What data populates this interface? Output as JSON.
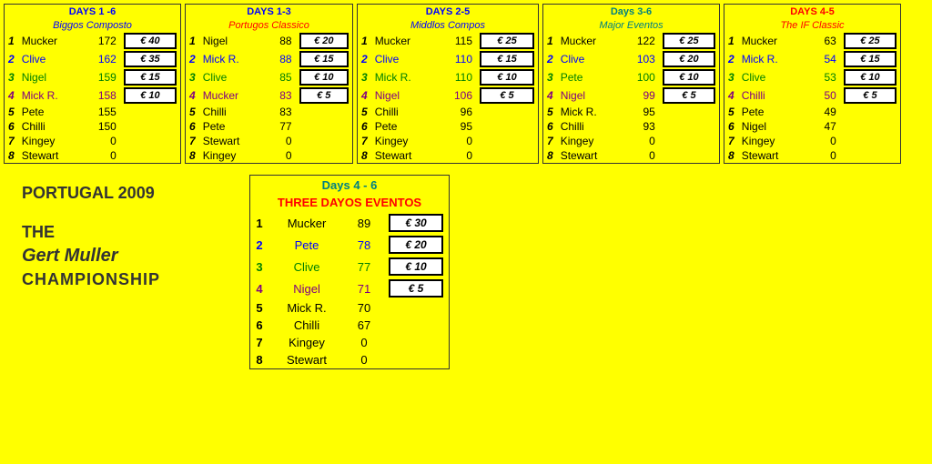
{
  "tournaments": [
    {
      "id": "days1-6",
      "header": "DAYS 1 -6",
      "header_color": "blue",
      "subheader": "Biggos Composto",
      "subheader_color": "blue",
      "rows": [
        {
          "rank": "1",
          "name": "Mucker",
          "score": "172",
          "prize": "€ 40"
        },
        {
          "rank": "2",
          "name": "Clive",
          "score": "162",
          "prize": "€ 35"
        },
        {
          "rank": "3",
          "name": "Nigel",
          "score": "159",
          "prize": "€ 15"
        },
        {
          "rank": "4",
          "name": "Mick R.",
          "score": "158",
          "prize": "€ 10"
        },
        {
          "rank": "5",
          "name": "Pete",
          "score": "155",
          "prize": null
        },
        {
          "rank": "6",
          "name": "Chilli",
          "score": "150",
          "prize": null
        },
        {
          "rank": "7",
          "name": "Kingey",
          "score": "0",
          "prize": null
        },
        {
          "rank": "8",
          "name": "Stewart",
          "score": "0",
          "prize": null
        }
      ]
    },
    {
      "id": "days1-3",
      "header": "DAYS 1-3",
      "header_color": "blue",
      "subheader": "Portugos Classico",
      "subheader_color": "red",
      "rows": [
        {
          "rank": "1",
          "name": "Nigel",
          "score": "88",
          "prize": "€ 20"
        },
        {
          "rank": "2",
          "name": "Mick R.",
          "score": "88",
          "prize": "€ 15"
        },
        {
          "rank": "3",
          "name": "Clive",
          "score": "85",
          "prize": "€ 10"
        },
        {
          "rank": "4",
          "name": "Mucker",
          "score": "83",
          "prize": "€ 5"
        },
        {
          "rank": "5",
          "name": "Chilli",
          "score": "83",
          "prize": null
        },
        {
          "rank": "6",
          "name": "Pete",
          "score": "77",
          "prize": null
        },
        {
          "rank": "7",
          "name": "Stewart",
          "score": "0",
          "prize": null
        },
        {
          "rank": "8",
          "name": "Kingey",
          "score": "0",
          "prize": null
        }
      ]
    },
    {
      "id": "days2-5",
      "header": "DAYS 2-5",
      "header_color": "blue",
      "subheader": "Middlos Compos",
      "subheader_color": "blue",
      "rows": [
        {
          "rank": "1",
          "name": "Mucker",
          "score": "115",
          "prize": "€ 25"
        },
        {
          "rank": "2",
          "name": "Clive",
          "score": "110",
          "prize": "€ 15"
        },
        {
          "rank": "3",
          "name": "Mick R.",
          "score": "110",
          "prize": "€ 10"
        },
        {
          "rank": "4",
          "name": "Nigel",
          "score": "106",
          "prize": "€ 5"
        },
        {
          "rank": "5",
          "name": "Chilli",
          "score": "96",
          "prize": null
        },
        {
          "rank": "6",
          "name": "Pete",
          "score": "95",
          "prize": null
        },
        {
          "rank": "7",
          "name": "Kingey",
          "score": "0",
          "prize": null
        },
        {
          "rank": "8",
          "name": "Stewart",
          "score": "0",
          "prize": null
        }
      ]
    },
    {
      "id": "days3-6",
      "header": "Days 3-6",
      "header_color": "teal",
      "subheader": "Major Eventos",
      "subheader_color": "teal",
      "rows": [
        {
          "rank": "1",
          "name": "Mucker",
          "score": "122",
          "prize": "€ 25"
        },
        {
          "rank": "2",
          "name": "Clive",
          "score": "103",
          "prize": "€ 20"
        },
        {
          "rank": "3",
          "name": "Pete",
          "score": "100",
          "prize": "€ 10"
        },
        {
          "rank": "4",
          "name": "Nigel",
          "score": "99",
          "prize": "€ 5"
        },
        {
          "rank": "5",
          "name": "Mick R.",
          "score": "95",
          "prize": null
        },
        {
          "rank": "6",
          "name": "Chilli",
          "score": "93",
          "prize": null
        },
        {
          "rank": "7",
          "name": "Kingey",
          "score": "0",
          "prize": null
        },
        {
          "rank": "8",
          "name": "Stewart",
          "score": "0",
          "prize": null
        }
      ]
    },
    {
      "id": "days4-5",
      "header": "DAYS 4-5",
      "header_color": "red",
      "subheader": "The IF Classic",
      "subheader_color": "red",
      "rows": [
        {
          "rank": "1",
          "name": "Mucker",
          "score": "63",
          "prize": "€ 25"
        },
        {
          "rank": "2",
          "name": "Mick R.",
          "score": "54",
          "prize": "€ 15"
        },
        {
          "rank": "3",
          "name": "Clive",
          "score": "53",
          "prize": "€ 10"
        },
        {
          "rank": "4",
          "name": "Chilli",
          "score": "50",
          "prize": "€ 5"
        },
        {
          "rank": "5",
          "name": "Pete",
          "score": "49",
          "prize": null
        },
        {
          "rank": "6",
          "name": "Nigel",
          "score": "47",
          "prize": null
        },
        {
          "rank": "7",
          "name": "Kingey",
          "score": "0",
          "prize": null
        },
        {
          "rank": "8",
          "name": "Stewart",
          "score": "0",
          "prize": null
        }
      ]
    }
  ],
  "bottom_left": {
    "portugal": "PORTUGAL 2009",
    "the": "THE",
    "gert": "Gert Muller",
    "championship": "CHAMPIONSHIP"
  },
  "days46": {
    "header": "Days 4 - 6",
    "subheader": "THREE DAYOS EVENTOS",
    "rows": [
      {
        "rank": "1",
        "name": "Mucker",
        "score": "89",
        "prize": "€ 30"
      },
      {
        "rank": "2",
        "name": "Pete",
        "score": "78",
        "prize": "€ 20"
      },
      {
        "rank": "3",
        "name": "Clive",
        "score": "77",
        "prize": "€ 10"
      },
      {
        "rank": "4",
        "name": "Nigel",
        "score": "71",
        "prize": "€ 5"
      },
      {
        "rank": "5",
        "name": "Mick R.",
        "score": "70",
        "prize": null
      },
      {
        "rank": "6",
        "name": "Chilli",
        "score": "67",
        "prize": null
      },
      {
        "rank": "7",
        "name": "Kingey",
        "score": "0",
        "prize": null
      },
      {
        "rank": "8",
        "name": "Stewart",
        "score": "0",
        "prize": null
      }
    ]
  }
}
